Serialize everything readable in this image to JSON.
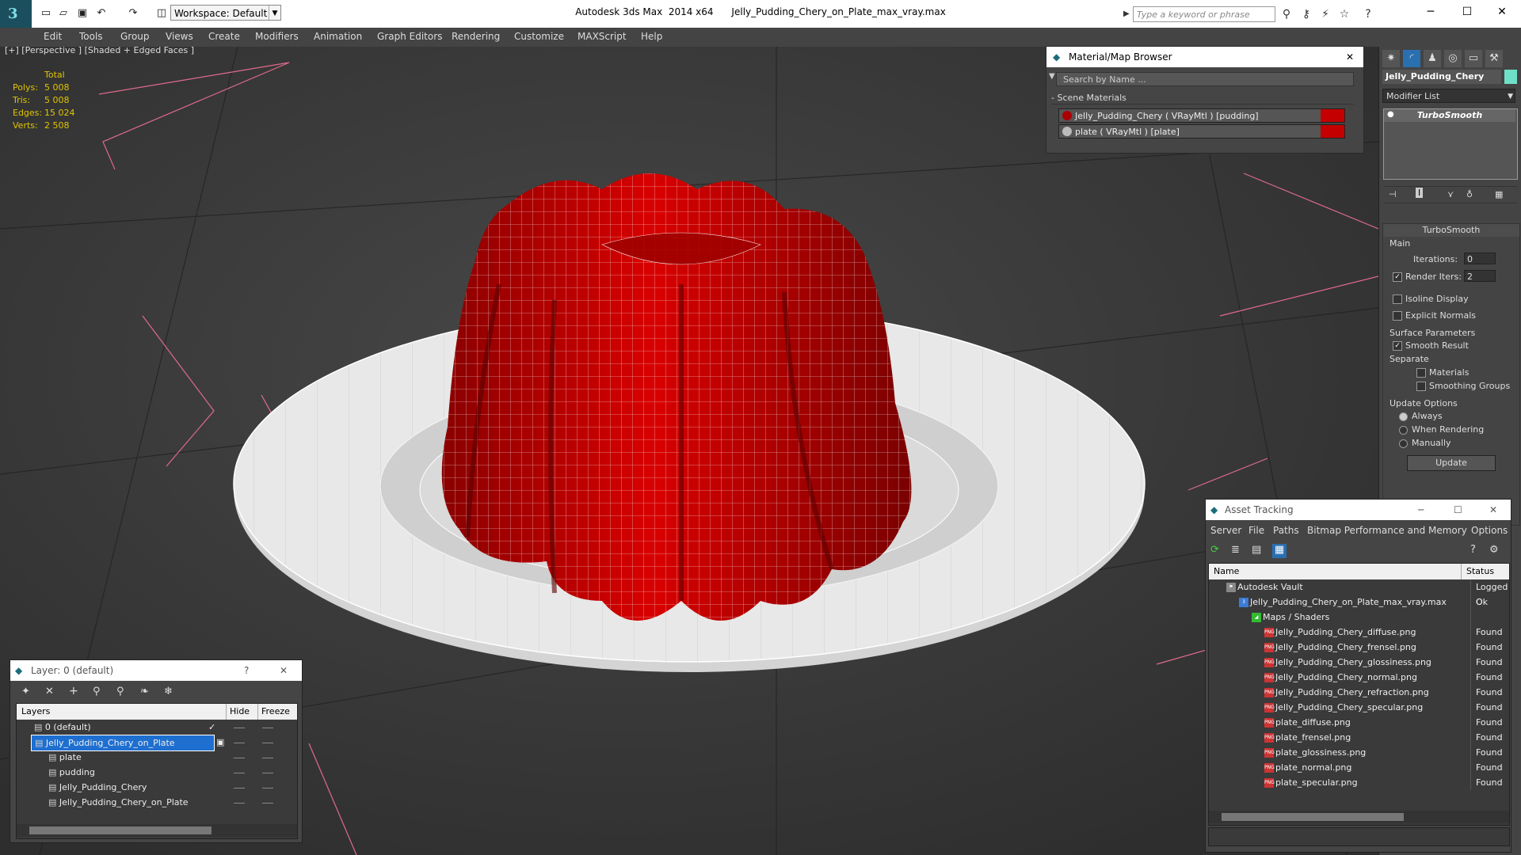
{
  "window": {
    "app_title": "Autodesk 3ds Max  2014 x64      Jelly_Pudding_Chery_on_Plate_max_vray.max",
    "workspace": "Workspace: Default",
    "search_placeholder": "Type a keyword or phrase"
  },
  "menubar": [
    "Edit",
    "Tools",
    "Group",
    "Views",
    "Create",
    "Modifiers",
    "Animation",
    "Graph Editors",
    "Rendering",
    "Customize",
    "MAXScript",
    "Help"
  ],
  "viewport": {
    "label": "[+] [Perspective ] [Shaded + Edged Faces ]",
    "stats_header": "Total",
    "stats": [
      {
        "label": "Polys:",
        "value": "5 008"
      },
      {
        "label": "Tris:",
        "value": "5 008"
      },
      {
        "label": "Edges:",
        "value": "15 024"
      },
      {
        "label": "Verts:",
        "value": "2 508"
      }
    ]
  },
  "material_browser": {
    "title": "Material/Map Browser",
    "search": "Search by Name ...",
    "section": "- Scene Materials",
    "materials": [
      "Jelly_Pudding_Chery  ( VRayMtl )  [pudding]",
      "plate  ( VRayMtl )  [plate]"
    ]
  },
  "command_panel": {
    "object_name": "Jelly_Pudding_Chery",
    "modifier_list": "Modifier List",
    "stack_item": "TurboSmooth",
    "rollout_title": "TurboSmooth",
    "main_label": "Main",
    "iterations_label": "Iterations:",
    "iterations_value": "0",
    "render_iters_label": "Render Iters:",
    "render_iters_value": "2",
    "isoline": "Isoline Display",
    "explicit": "Explicit Normals",
    "surface_params": "Surface Parameters",
    "smooth_result": "Smooth Result",
    "separate": "Separate",
    "materials": "Materials",
    "smoothing_groups": "Smoothing Groups",
    "update_options": "Update Options",
    "always": "Always",
    "when_rendering": "When Rendering",
    "manually": "Manually",
    "update_btn": "Update"
  },
  "asset_tracking": {
    "title": "Asset Tracking",
    "menu": [
      "Server",
      "File",
      "Paths",
      "Bitmap Performance and Memory",
      "Options"
    ],
    "col_name": "Name",
    "col_status": "Status",
    "rows": [
      {
        "name": "Autodesk Vault",
        "status": "Logged O",
        "indent": 0,
        "icon": "vault"
      },
      {
        "name": "Jelly_Pudding_Chery_on_Plate_max_vray.max",
        "status": "Ok",
        "indent": 1,
        "icon": "max"
      },
      {
        "name": "Maps / Shaders",
        "status": "",
        "indent": 2,
        "icon": "maps"
      },
      {
        "name": "Jelly_Pudding_Chery_diffuse.png",
        "status": "Found",
        "indent": 3,
        "icon": "png"
      },
      {
        "name": "Jelly_Pudding_Chery_frensel.png",
        "status": "Found",
        "indent": 3,
        "icon": "png"
      },
      {
        "name": "Jelly_Pudding_Chery_glossiness.png",
        "status": "Found",
        "indent": 3,
        "icon": "png"
      },
      {
        "name": "Jelly_Pudding_Chery_normal.png",
        "status": "Found",
        "indent": 3,
        "icon": "png"
      },
      {
        "name": "Jelly_Pudding_Chery_refraction.png",
        "status": "Found",
        "indent": 3,
        "icon": "png"
      },
      {
        "name": "Jelly_Pudding_Chery_specular.png",
        "status": "Found",
        "indent": 3,
        "icon": "png"
      },
      {
        "name": "plate_diffuse.png",
        "status": "Found",
        "indent": 3,
        "icon": "png"
      },
      {
        "name": "plate_frensel.png",
        "status": "Found",
        "indent": 3,
        "icon": "png"
      },
      {
        "name": "plate_glossiness.png",
        "status": "Found",
        "indent": 3,
        "icon": "png"
      },
      {
        "name": "plate_normal.png",
        "status": "Found",
        "indent": 3,
        "icon": "png"
      },
      {
        "name": "plate_specular.png",
        "status": "Found",
        "indent": 3,
        "icon": "png"
      }
    ]
  },
  "layer_panel": {
    "title": "Layer: 0 (default)",
    "col_layers": "Layers",
    "col_hide": "Hide",
    "col_freeze": "Freeze",
    "rows": [
      {
        "name": "0 (default)",
        "indent": 1,
        "selected": false
      },
      {
        "name": "Jelly_Pudding_Chery_on_Plate",
        "indent": 1,
        "selected": true
      },
      {
        "name": "plate",
        "indent": 2,
        "selected": false
      },
      {
        "name": "pudding",
        "indent": 2,
        "selected": false
      },
      {
        "name": "Jelly_Pudding_Chery",
        "indent": 2,
        "selected": false
      },
      {
        "name": "Jelly_Pudding_Chery_on_Plate",
        "indent": 2,
        "selected": false
      }
    ]
  },
  "colors": {
    "accent": "#3399ff",
    "selection": "#1e6fd0",
    "pudding": "#c40000",
    "plate": "#e6e6e6"
  }
}
